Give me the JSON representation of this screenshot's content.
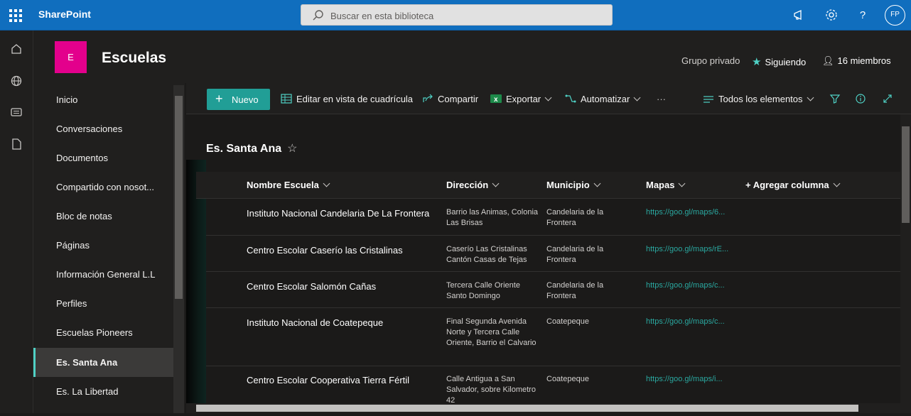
{
  "topbar": {
    "brand": "SharePoint",
    "search_placeholder": "Buscar en esta biblioteca",
    "avatar_initials": "FP"
  },
  "site": {
    "logo_letter": "E",
    "title": "Escuelas",
    "privacy": "Grupo privado",
    "follow_label": "Siguiendo",
    "members_label": "16 miembros"
  },
  "nav": {
    "items": [
      {
        "label": "Inicio"
      },
      {
        "label": "Conversaciones"
      },
      {
        "label": "Documentos"
      },
      {
        "label": "Compartido con nosot..."
      },
      {
        "label": "Bloc de notas"
      },
      {
        "label": "Páginas"
      },
      {
        "label": "Información General L.L"
      },
      {
        "label": "Perfiles"
      },
      {
        "label": "Escuelas Pioneers"
      },
      {
        "label": "Es. Santa Ana"
      },
      {
        "label": "Es. La Libertad"
      }
    ],
    "selected": "Es. Santa Ana"
  },
  "commandbar": {
    "new_label": "Nuevo",
    "grid_edit_label": "Editar en vista de cuadrícula",
    "share_label": "Compartir",
    "export_label": "Exportar",
    "automate_label": "Automatizar",
    "more_label": "···",
    "view_label": "Todos los elementos"
  },
  "list": {
    "title": "Es. Santa Ana",
    "columns": {
      "name": "Nombre Escuela",
      "address": "Dirección",
      "municipality": "Municipio",
      "maps": "Mapas",
      "add_column": "+ Agregar columna"
    },
    "rows": [
      {
        "name": "Instituto Nacional Candelaria De La Frontera",
        "address": "Barrio las Animas, Colonia Las Brisas",
        "municipality": "Candelaria de la Frontera",
        "map": "https://goo.gl/maps/6..."
      },
      {
        "name": "Centro Escolar Caserío las Cristalinas",
        "address": "Caserío Las Cristalinas Cantón Casas de Tejas",
        "municipality": "Candelaria de la Frontera",
        "map": "https://goo.gl/maps/rE..."
      },
      {
        "name": "Centro Escolar Salomón Cañas",
        "address": "Tercera Calle Oriente Santo Domingo",
        "municipality": "Candelaria de la Frontera",
        "map": "https://goo.gl/maps/c..."
      },
      {
        "name": "Instituto Nacional de Coatepeque",
        "address": "Final Segunda Avenida Norte y Tercera Calle Oriente, Barrio el Calvario",
        "municipality": "Coatepeque",
        "map": "https://goo.gl/maps/c..."
      },
      {
        "name": "Centro Escolar Cooperativa Tierra Fértil",
        "address": "Calle Antigua a San Salvador, sobre Kilometro 42",
        "municipality": "Coatepeque",
        "map": "https://goo.gl/maps/i..."
      }
    ]
  },
  "colors": {
    "suite_bar": "#106ebe",
    "accent": "#219e96",
    "site_logo": "#e3008c"
  }
}
